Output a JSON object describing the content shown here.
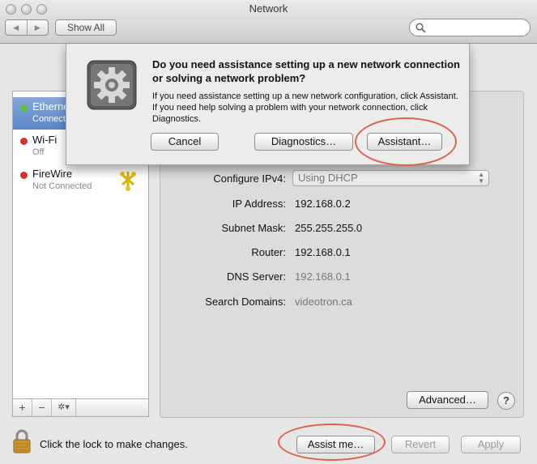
{
  "window": {
    "title": "Network"
  },
  "toolbar": {
    "back_glyph": "◀",
    "forward_glyph": "▶",
    "show_all_label": "Show All",
    "search_placeholder": ""
  },
  "sidebar": {
    "services": [
      {
        "name": "Ethernet",
        "status": "Connected",
        "status_color": "#5fbf3c",
        "selected": true
      },
      {
        "name": "Wi-Fi",
        "status": "Off",
        "status_color": "#d9302c",
        "selected": false
      },
      {
        "name": "FireWire",
        "status": "Not Connected",
        "status_color": "#d9302c",
        "selected": false
      }
    ],
    "add_glyph": "+",
    "remove_glyph": "−",
    "action_glyph": "✲▾"
  },
  "detail": {
    "configure_ipv4": {
      "label": "Configure IPv4:",
      "value": "Using DHCP"
    },
    "ip_address": {
      "label": "IP Address:",
      "value": "192.168.0.2"
    },
    "subnet_mask": {
      "label": "Subnet Mask:",
      "value": "255.255.255.0"
    },
    "router": {
      "label": "Router:",
      "value": "192.168.0.1"
    },
    "dns_server": {
      "label": "DNS Server:",
      "value": "192.168.0.1"
    },
    "search_domains": {
      "label": "Search Domains:",
      "value": "videotron.ca"
    },
    "advanced_label": "Advanced…",
    "help_label": "?"
  },
  "bottom": {
    "lock_text": "Click the lock to make changes.",
    "assist_label": "Assist me…",
    "revert_label": "Revert",
    "apply_label": "Apply"
  },
  "dialog": {
    "headline": "Do you need assistance setting up a new network connection or solving a network problem?",
    "body": "If you need assistance setting up a new network configuration, click Assistant. If you need help solving a problem with your network connection, click Diagnostics.",
    "cancel_label": "Cancel",
    "diagnostics_label": "Diagnostics…",
    "assistant_label": "Assistant…"
  },
  "colors": {
    "selection": "#5c86c7",
    "callout": "#d8644d"
  }
}
